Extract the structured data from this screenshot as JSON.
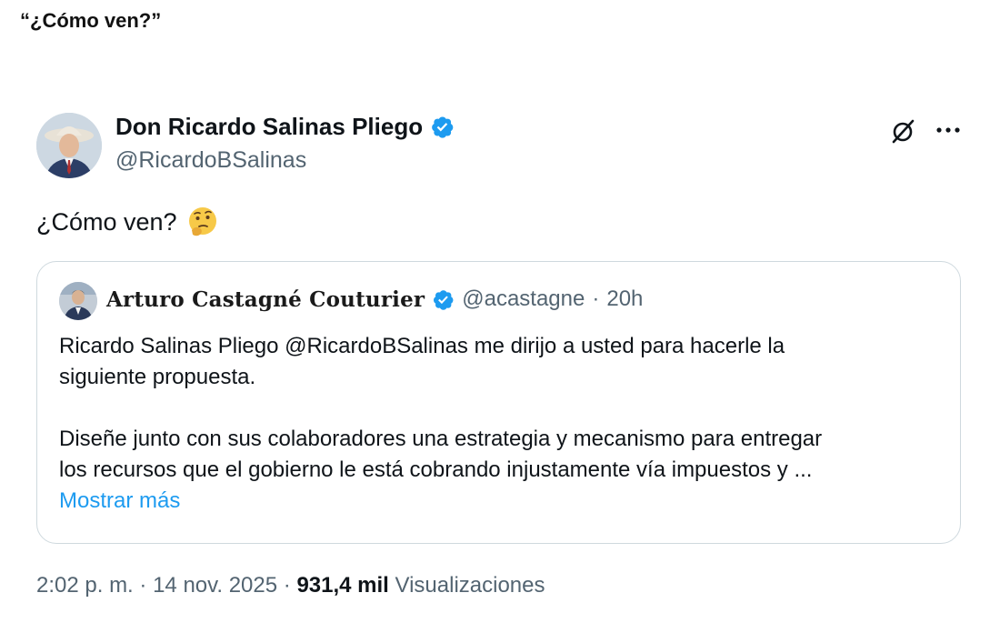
{
  "caption": "“¿Cómo ven?”",
  "tweet": {
    "author_name": "Don Ricardo Salinas Pliego",
    "author_handle": "@RicardoBSalinas",
    "text": "¿Cómo ven?",
    "emoji": "thinking-face",
    "verified_color": "#1d9bf0"
  },
  "quote": {
    "author_name": "Arturo Castagné Couturier",
    "handle": "@acastagne",
    "separator": "·",
    "time": "20h",
    "lines": [
      "Ricardo Salinas Pliego @RicardoBSalinas me dirijo a usted para hacerle la",
      "siguiente propuesta.",
      "",
      "Diseñe junto con sus colaboradores una estrategia y mecanismo para entregar",
      "los recursos que el gobierno le está cobrando injustamente vía impuestos y ..."
    ],
    "show_more": "Mostrar más"
  },
  "footer": {
    "time": "2:02 p. m.",
    "sep1": "·",
    "date": "14 nov. 2025",
    "sep2": "·",
    "views_count": "931,4 mil",
    "views_label": "Visualizaciones"
  },
  "colors": {
    "accent": "#1d9bf0",
    "secondary_text": "#536471",
    "border": "#cfd9de"
  }
}
